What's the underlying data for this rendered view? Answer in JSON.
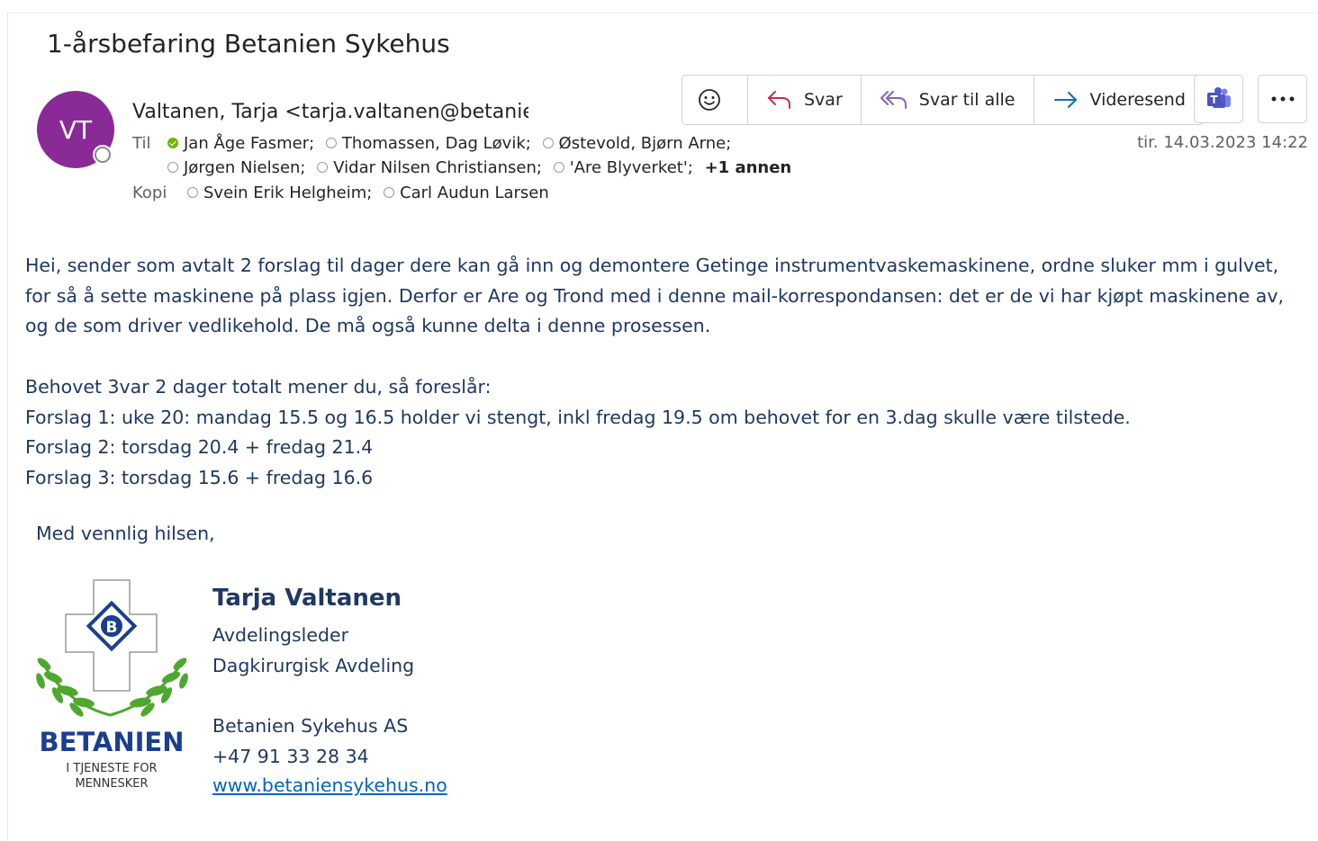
{
  "email": {
    "subject": "1-årsbefaring Betanien Sykehus",
    "sender": {
      "initials": "VT",
      "display": "Valtanen, Tarja <tarja.valtanen@betanien.no>",
      "avatar_color": "#8a2a96"
    },
    "to_label": "Til",
    "cc_label": "Kopi",
    "to_line1": [
      {
        "name": "Jan Åge Fasmer;",
        "status": "available"
      },
      {
        "name": "Thomassen, Dag Løvik;",
        "status": "offline"
      },
      {
        "name": "Østevold, Bjørn Arne;",
        "status": "offline"
      }
    ],
    "to_line2": [
      {
        "name": "Jørgen Nielsen;",
        "status": "offline"
      },
      {
        "name": "Vidar Nilsen Christiansen;",
        "status": "offline"
      },
      {
        "name": "'Are Blyverket';",
        "status": "offline"
      }
    ],
    "to_more": "+1 annen",
    "cc": [
      {
        "name": "Svein Erik Helgheim;",
        "status": "offline"
      },
      {
        "name": "Carl Audun Larsen",
        "status": "offline"
      }
    ],
    "datetime": "tir. 14.03.2023 14:22"
  },
  "actions": {
    "reply": "Svar",
    "reply_all": "Svar til alle",
    "forward": "Videresend"
  },
  "body": {
    "paragraph1": "Hei, sender som avtalt 2 forslag til dager dere kan gå inn og demontere Getinge instrumentvaskemaskinene, ordne sluker mm i gulvet, for så å sette maskinene på plass igjen. Derfor er Are og Trond med i denne mail-korrespondansen: det er de vi har kjøpt maskinene av, og de som driver vedlikehold. De må også kunne delta i denne prosessen.",
    "line_need": "Behovet 3var 2 dager totalt mener du, så foreslår:",
    "proposal1": "Forslag 1: uke 20: mandag 15.5 og 16.5 holder vi stengt, inkl fredag 19.5 om behovet for en 3.dag skulle være tilstede.",
    "proposal2": "Forslag 2: torsdag 20.4 + fredag 21.4",
    "proposal3": "Forslag 3: torsdag 15.6 + fredag 16.6",
    "greeting": "Med vennlig hilsen,"
  },
  "signature": {
    "name": "Tarja Valtanen",
    "title": "Avdelingsleder",
    "department": "Dagkirurgisk Avdeling",
    "company": "Betanien Sykehus AS",
    "phone": "+47 91 33 28 34",
    "website": "www.betaniensykehus.no",
    "logo_text": "BETANIEN",
    "logo_tagline_1": "I TJENESTE FOR",
    "logo_tagline_2": "MENNESKER",
    "logo_letter": "B"
  },
  "colors": {
    "body_text": "#1f3864",
    "link": "#0563c1",
    "accent": "#0f6cbd",
    "logo_blue": "#1b3f8f",
    "logo_green": "#4ea72e"
  },
  "icons": [
    "emoji-icon",
    "reply-icon",
    "reply-all-icon",
    "forward-icon",
    "teams-icon",
    "more-icon"
  ]
}
